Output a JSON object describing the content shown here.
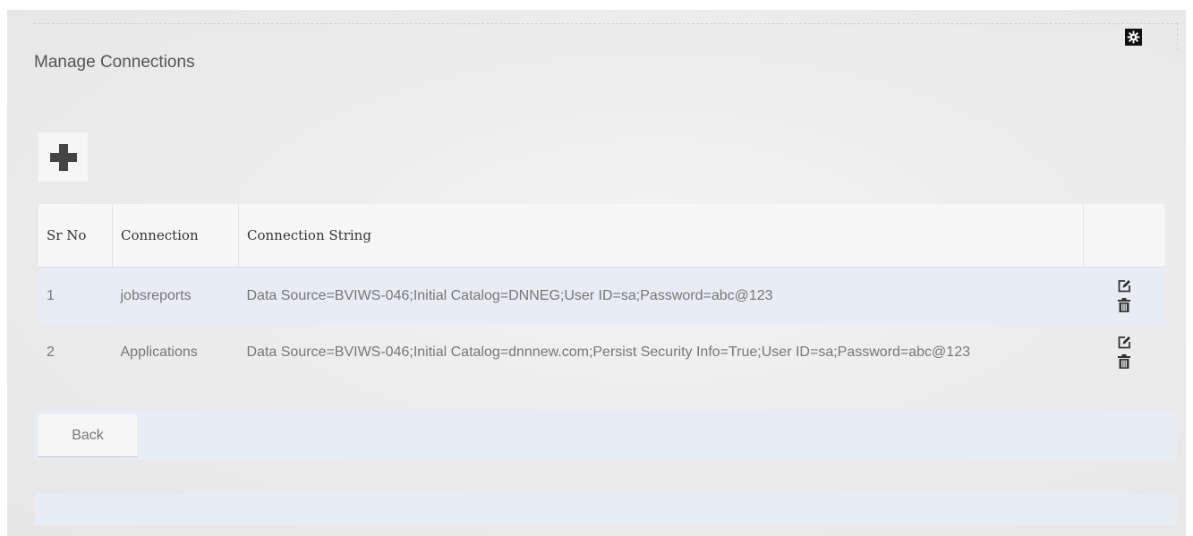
{
  "page": {
    "title": "Manage Connections"
  },
  "toolbar": {
    "add_icon": "plus-icon",
    "settings_icon": "gear-icon"
  },
  "table": {
    "headers": {
      "sr_no": "Sr No",
      "connection": "Connection",
      "connection_string": "Connection String",
      "actions": ""
    },
    "rows": [
      {
        "sr_no": "1",
        "connection": "jobsreports",
        "connection_string": "Data Source=BVIWS-046;Initial Catalog=DNNEG;User ID=sa;Password=abc@123"
      },
      {
        "sr_no": "2",
        "connection": "Applications",
        "connection_string": "Data Source=BVIWS-046;Initial Catalog=dnnnew.com;Persist Security Info=True;User ID=sa;Password=abc@123"
      }
    ],
    "row_actions": [
      "edit-icon",
      "trash-icon"
    ]
  },
  "footer": {
    "back_label": "Back"
  },
  "colors": {
    "alt_row": "#e8ecf4",
    "header_bg": "#f7f7f7",
    "text": "#777777"
  }
}
